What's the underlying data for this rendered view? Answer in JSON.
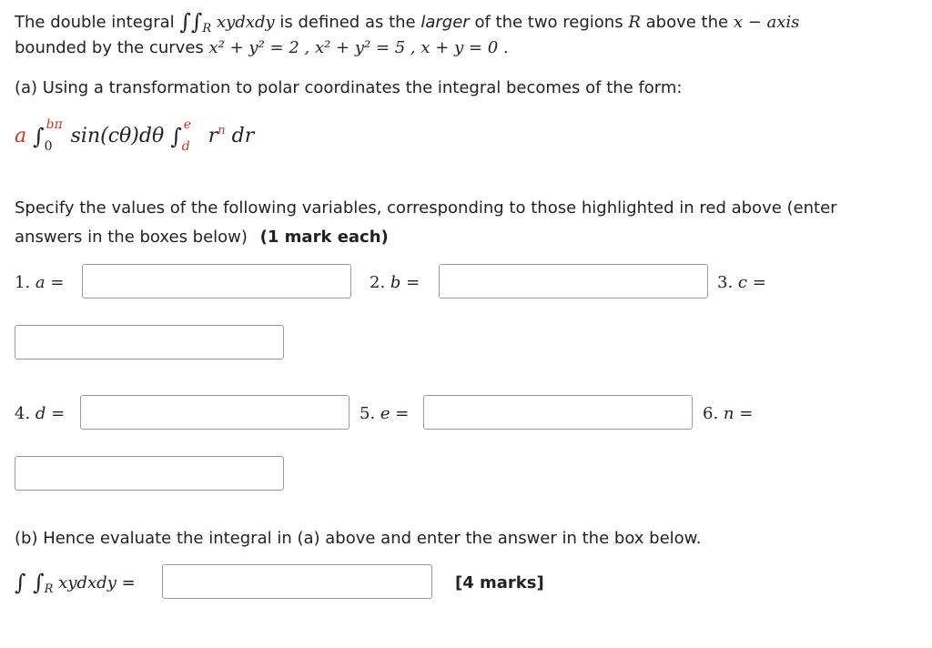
{
  "intro": {
    "t1": "The double integral",
    "integrand": "xydxdy",
    "t2": "is defined as the",
    "larger": "larger",
    "t3": "of  the two regions",
    "R": "R",
    "t4": "above the",
    "axis": "x − axis",
    "line2_a": "bounded by the curves",
    "curve1": "x² + y² = 2 ,",
    "curve2": "x² + y² = 5 ,",
    "curve3": "x + y = 0 ."
  },
  "part_a": {
    "text": "(a) Using a transformation to polar coordinates the integral becomes of the form:",
    "formula": {
      "a": "a",
      "upper1": "bπ",
      "lower1": "0",
      "middle": "sin(cθ)dθ",
      "upper2": "e",
      "lower2": "d",
      "r": "r",
      "n": "n",
      "dr": "dr"
    }
  },
  "instructions": {
    "line1": "Specify the values of the following variables, corresponding to those highlighted in red above (enter",
    "line2": "answers in the boxes below)",
    "marks": "(1 mark each)"
  },
  "fields": {
    "a_label": "1.",
    "a_var": "a =",
    "b_label": "2.",
    "b_var": "b =",
    "c_label": "3.",
    "c_var": "c =",
    "d_label": "4.",
    "d_var": "d =",
    "e_label": "5.",
    "e_var": "e =",
    "n_label": "6.",
    "n_var": "n ="
  },
  "part_b": {
    "text": "(b) Hence evaluate the integral in (a) above and enter the answer in the box below.",
    "integrand": "xydxdy",
    "eq": "=",
    "marks": "[4 marks]"
  }
}
